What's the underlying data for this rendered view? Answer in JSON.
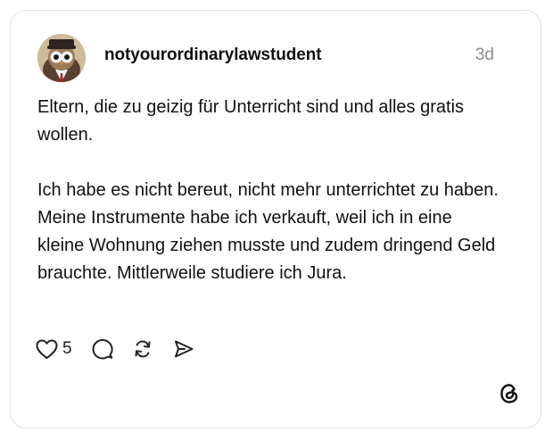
{
  "post": {
    "username": "notyourordinarylawstudent",
    "time": "3d",
    "paragraph_1": "Eltern, die zu geizig für Unterricht sind und alles gratis wollen.",
    "paragraph_2": "Ich habe es nicht bereut, nicht mehr unterrichtet zu haben. Meine Instrumente habe ich verkauft, weil ich in eine kleine Wohnung ziehen musste und zudem dringend Geld brauchte. Mittlerweile studiere ich Jura."
  },
  "actions": {
    "like_count": "5"
  },
  "icons": {
    "like": "heart-icon",
    "comment": "comment-icon",
    "repost": "repost-icon",
    "share": "send-icon",
    "brand": "threads-logo-icon"
  }
}
